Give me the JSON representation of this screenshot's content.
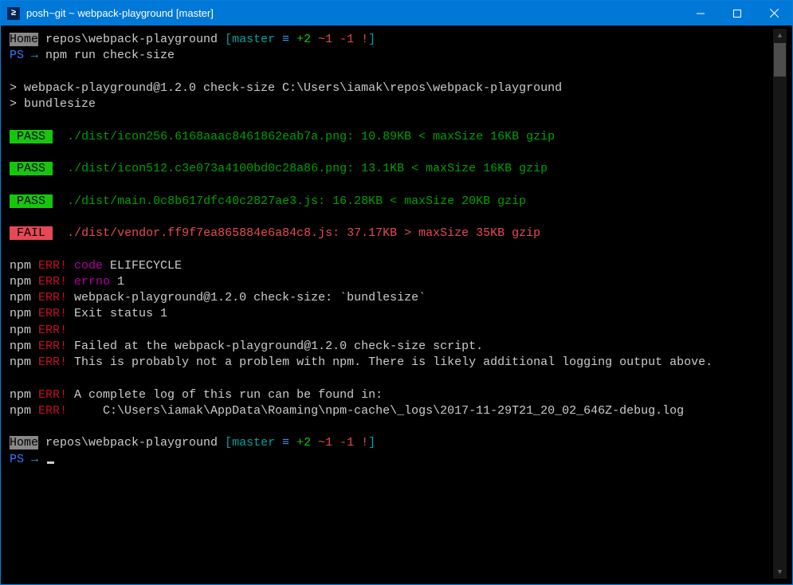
{
  "titlebar": {
    "icon_text": "≥",
    "title": "posh~git ~ webpack-playground [master]"
  },
  "prompt": {
    "home": "Home",
    "path": " repos\\webpack-playground ",
    "branch_open": "[",
    "branch": "master",
    "equiv": " ≡",
    "plus": " +2",
    "tilde": " ~1",
    "minus": " -1",
    "bang": " !",
    "branch_close": "]",
    "ps": "PS",
    "arrow": " → ",
    "cmd": "npm run check-size"
  },
  "script_header": {
    "line1": "> webpack-playground@1.2.0 check-size C:\\Users\\iamak\\repos\\webpack-playground",
    "line2": "> bundlesize"
  },
  "checks": [
    {
      "status": "PASS",
      "text": "./dist/icon256.6168aaac8461862eab7a.png: 10.89KB < maxSize 16KB gzip"
    },
    {
      "status": "PASS",
      "text": "./dist/icon512.c3e073a4100bd0c28a86.png: 13.1KB < maxSize 16KB gzip"
    },
    {
      "status": "PASS",
      "text": "./dist/main.0c8b617dfc40c2827ae3.js: 16.28KB < maxSize 20KB gzip"
    },
    {
      "status": "FAIL",
      "text": "./dist/vendor.ff9f7ea865884e6a84c8.js: 37.17KB > maxSize 35KB gzip"
    }
  ],
  "err": {
    "npm": "npm",
    "err_label": " ERR!",
    "code_label": " code",
    "code_val": " ELIFECYCLE",
    "errno_label": " errno",
    "errno_val": " 1",
    "line3": " webpack-playground@1.2.0 check-size: `bundlesize`",
    "line4": " Exit status 1",
    "line6": " Failed at the webpack-playground@1.2.0 check-size script.",
    "line7": " This is probably not a problem with npm. There is likely additional logging output above.",
    "line9": " A complete log of this run can be found in:",
    "line10": "     C:\\Users\\iamak\\AppData\\Roaming\\npm-cache\\_logs\\2017-11-29T21_20_02_646Z-debug.log"
  }
}
